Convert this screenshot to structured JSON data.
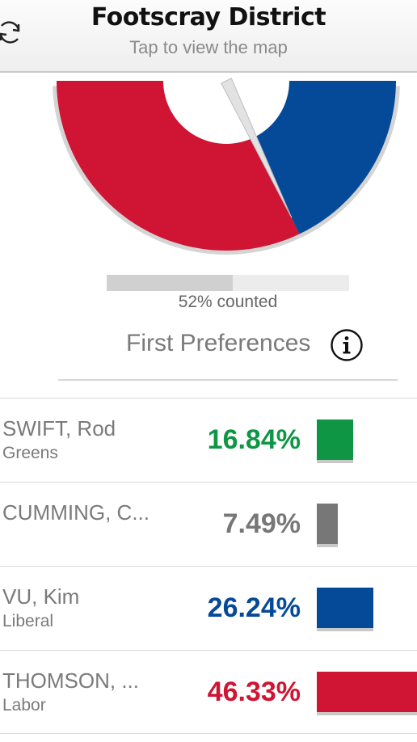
{
  "header": {
    "title": "Footscray District",
    "subtitle": "Tap to view the map",
    "refresh_icon": "refresh-icon"
  },
  "colors": {
    "greens": "#0e9644",
    "independent": "#777777",
    "liberal": "#054a99",
    "labor": "#d01433"
  },
  "gauge": {
    "segments": [
      {
        "party": "Labor",
        "color": "#d01433",
        "fraction": 0.6417
      },
      {
        "party": "Liberal",
        "color": "#054a99",
        "fraction": 0.3583
      }
    ]
  },
  "progress": {
    "value": 52,
    "label": "52% counted"
  },
  "section": {
    "title": "First Preferences",
    "info_icon": "info-icon"
  },
  "candidates": [
    {
      "name": "SWIFT, Rod",
      "party": "Greens",
      "percent": "16.84%",
      "value": 16.84,
      "color": "#0e9644"
    },
    {
      "name": "CUMMING, C...",
      "party": "",
      "percent": "7.49%",
      "value": 7.49,
      "color": "#777777"
    },
    {
      "name": "VU, Kim",
      "party": "Liberal",
      "percent": "26.24%",
      "value": 26.24,
      "color": "#054a99"
    },
    {
      "name": "THOMSON, ...",
      "party": "Labor",
      "percent": "46.33%",
      "value": 46.33,
      "color": "#d01433"
    }
  ]
}
